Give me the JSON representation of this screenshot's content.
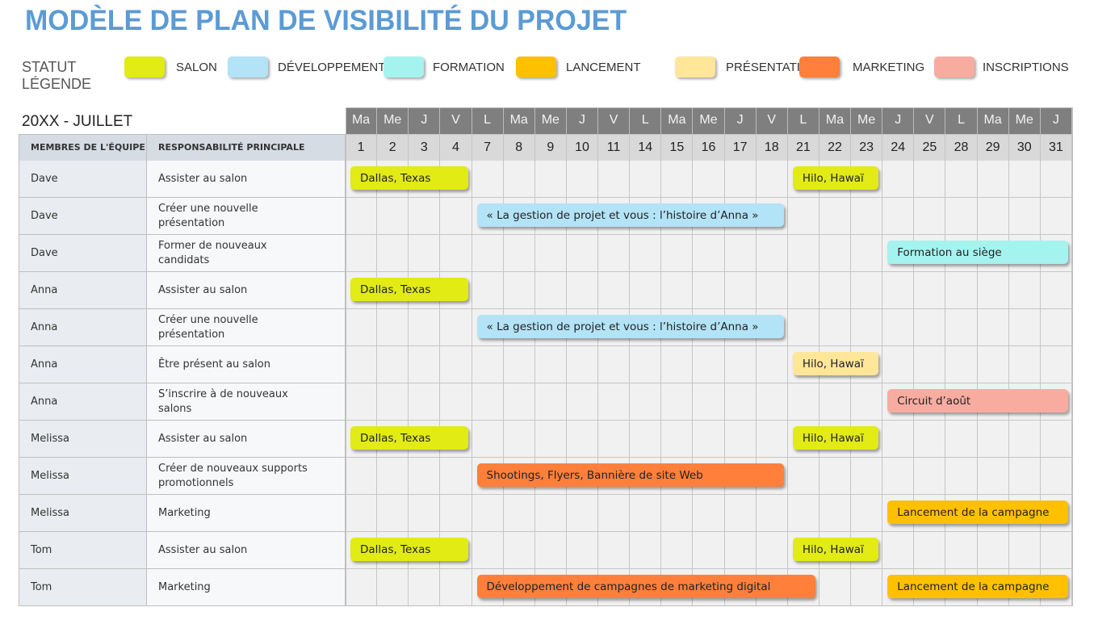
{
  "title": "MODÈLE DE PLAN DE VISIBILITÉ DU PROJET",
  "legend": {
    "label_line1": "STATUT",
    "label_line2": "LÉGENDE",
    "items": [
      {
        "key": "salon",
        "label": "SALON",
        "color": "#e2eb14"
      },
      {
        "key": "developpement",
        "label": "DÉVELOPPEMENT",
        "color": "#b3e3f7"
      },
      {
        "key": "formation",
        "label": "FORMATION",
        "color": "#a5f3ef"
      },
      {
        "key": "lancement",
        "label": "LANCEMENT",
        "color": "#ffc000"
      },
      {
        "key": "presentation",
        "label": "PRÉSENTATION",
        "color": "#ffe699"
      },
      {
        "key": "marketing",
        "label": "MARKETING",
        "color": "#ff7f3b"
      },
      {
        "key": "inscriptions",
        "label": "INSCRIPTIONS",
        "color": "#f8aca0"
      }
    ]
  },
  "calendar": {
    "month_label": "20XX - JUILLET",
    "columns": {
      "member": "MEMBRES DE L'ÉQUIPE",
      "responsibility": "RESPONSABILITÉ PRINCIPALE"
    },
    "days": [
      {
        "dow": "Ma",
        "day": "1"
      },
      {
        "dow": "Me",
        "day": "2"
      },
      {
        "dow": "J",
        "day": "3"
      },
      {
        "dow": "V",
        "day": "4"
      },
      {
        "dow": "L",
        "day": "7"
      },
      {
        "dow": "Ma",
        "day": "8"
      },
      {
        "dow": "Me",
        "day": "9"
      },
      {
        "dow": "J",
        "day": "10"
      },
      {
        "dow": "V",
        "day": "11"
      },
      {
        "dow": "L",
        "day": "14"
      },
      {
        "dow": "Ma",
        "day": "15"
      },
      {
        "dow": "Me",
        "day": "16"
      },
      {
        "dow": "J",
        "day": "17"
      },
      {
        "dow": "V",
        "day": "18"
      },
      {
        "dow": "L",
        "day": "21"
      },
      {
        "dow": "Ma",
        "day": "22"
      },
      {
        "dow": "Me",
        "day": "23"
      },
      {
        "dow": "J",
        "day": "24"
      },
      {
        "dow": "V",
        "day": "25"
      },
      {
        "dow": "L",
        "day": "28"
      },
      {
        "dow": "Ma",
        "day": "29"
      },
      {
        "dow": "Me",
        "day": "30"
      },
      {
        "dow": "J",
        "day": "31"
      }
    ],
    "rows": [
      {
        "member": "Dave",
        "responsibility": "Assister au salon",
        "tasks": [
          {
            "label": "Dallas, Texas",
            "status": "salon",
            "start_day": "1",
            "end_day": "4"
          },
          {
            "label": "Hilo, Hawaï",
            "status": "salon",
            "start_day": "21",
            "end_day": "23"
          }
        ]
      },
      {
        "member": "Dave",
        "responsibility": "Créer une nouvelle présentation",
        "tasks": [
          {
            "label": "« La gestion de projet et vous : l’histoire d’Anna »",
            "status": "developpement",
            "start_day": "7",
            "end_day": "18"
          }
        ]
      },
      {
        "member": "Dave",
        "responsibility": "Former de nouveaux candidats",
        "tasks": [
          {
            "label": "Formation au siège",
            "status": "formation",
            "start_day": "24",
            "end_day": "31"
          }
        ]
      },
      {
        "member": "Anna",
        "responsibility": "Assister au salon",
        "tasks": [
          {
            "label": "Dallas, Texas",
            "status": "salon",
            "start_day": "1",
            "end_day": "4"
          }
        ]
      },
      {
        "member": "Anna",
        "responsibility": "Créer une nouvelle présentation",
        "tasks": [
          {
            "label": "« La gestion de projet et vous : l’histoire d’Anna »",
            "status": "developpement",
            "start_day": "7",
            "end_day": "18"
          }
        ]
      },
      {
        "member": "Anna",
        "responsibility": "Être présent au salon",
        "tasks": [
          {
            "label": "Hilo, Hawaï",
            "status": "presentation",
            "start_day": "21",
            "end_day": "23"
          }
        ]
      },
      {
        "member": "Anna",
        "responsibility": "S’inscrire à de nouveaux salons",
        "tasks": [
          {
            "label": "Circuit d’août",
            "status": "inscriptions",
            "start_day": "24",
            "end_day": "31"
          }
        ]
      },
      {
        "member": "Melissa",
        "responsibility": "Assister au salon",
        "tasks": [
          {
            "label": "Dallas, Texas",
            "status": "salon",
            "start_day": "1",
            "end_day": "4"
          },
          {
            "label": "Hilo, Hawaï",
            "status": "salon",
            "start_day": "21",
            "end_day": "23"
          }
        ]
      },
      {
        "member": "Melissa",
        "responsibility": "Créer de nouveaux supports promotionnels",
        "tasks": [
          {
            "label": "Shootings, Flyers, Bannière de site Web",
            "status": "marketing",
            "start_day": "7",
            "end_day": "18"
          }
        ]
      },
      {
        "member": "Melissa",
        "responsibility": "Marketing",
        "tasks": [
          {
            "label": "Lancement de la campagne",
            "status": "lancement",
            "start_day": "24",
            "end_day": "31"
          }
        ]
      },
      {
        "member": "Tom",
        "responsibility": "Assister au salon",
        "tasks": [
          {
            "label": "Dallas, Texas",
            "status": "salon",
            "start_day": "1",
            "end_day": "4"
          },
          {
            "label": "Hilo, Hawaï",
            "status": "salon",
            "start_day": "21",
            "end_day": "23"
          }
        ]
      },
      {
        "member": "Tom",
        "responsibility": "Marketing",
        "tasks": [
          {
            "label": "Développement de campagnes de marketing digital",
            "status": "marketing",
            "start_day": "7",
            "end_day": "21"
          },
          {
            "label": "Lancement de la campagne",
            "status": "lancement",
            "start_day": "24",
            "end_day": "31"
          }
        ]
      }
    ]
  }
}
